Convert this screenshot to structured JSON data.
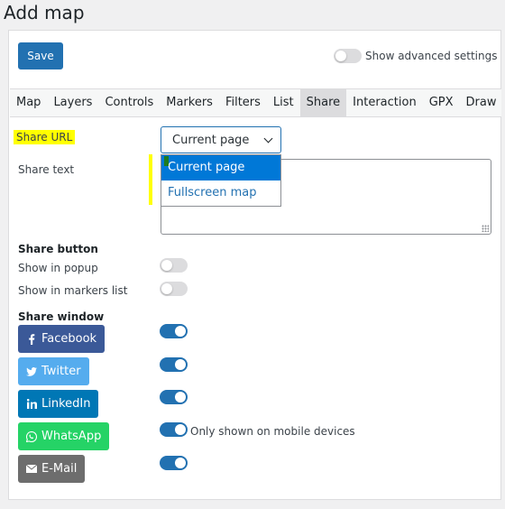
{
  "page": {
    "title": "Add map"
  },
  "toolbar": {
    "save_label": "Save",
    "advanced_label": "Show advanced settings"
  },
  "tabs": [
    {
      "label": "Map"
    },
    {
      "label": "Layers"
    },
    {
      "label": "Controls"
    },
    {
      "label": "Markers"
    },
    {
      "label": "Filters"
    },
    {
      "label": "List"
    },
    {
      "label": "Share"
    },
    {
      "label": "Interaction"
    },
    {
      "label": "GPX"
    },
    {
      "label": "Draw"
    }
  ],
  "active_tab": "Share",
  "share": {
    "url_label": "Share URL",
    "url_value": "Current page",
    "url_options": [
      "Current page",
      "Fullscreen map"
    ],
    "text_label": "Share text",
    "text_value": "",
    "button_section": "Share button",
    "show_in_popup": {
      "label": "Show in popup",
      "enabled": false
    },
    "show_in_list": {
      "label": "Show in markers list",
      "enabled": false
    },
    "window_section": "Share window",
    "networks": [
      {
        "label": "Facebook",
        "icon": "facebook-icon",
        "color": "#3b5998",
        "enabled": true
      },
      {
        "label": "Twitter",
        "icon": "twitter-icon",
        "color": "#55acee",
        "enabled": true
      },
      {
        "label": "LinkedIn",
        "icon": "linkedin-icon",
        "color": "#0077b5",
        "enabled": true
      },
      {
        "label": "WhatsApp",
        "icon": "whatsapp-icon",
        "color": "#25d366",
        "enabled": true
      },
      {
        "label": "E-Mail",
        "icon": "email-icon",
        "color": "#6d6d6d",
        "enabled": true
      }
    ],
    "whatsapp_note": "Only shown on mobile devices"
  },
  "colors": {
    "accent": "#2271b1",
    "highlight": "#ffff00",
    "dropdown_selected": "#0078d7"
  }
}
